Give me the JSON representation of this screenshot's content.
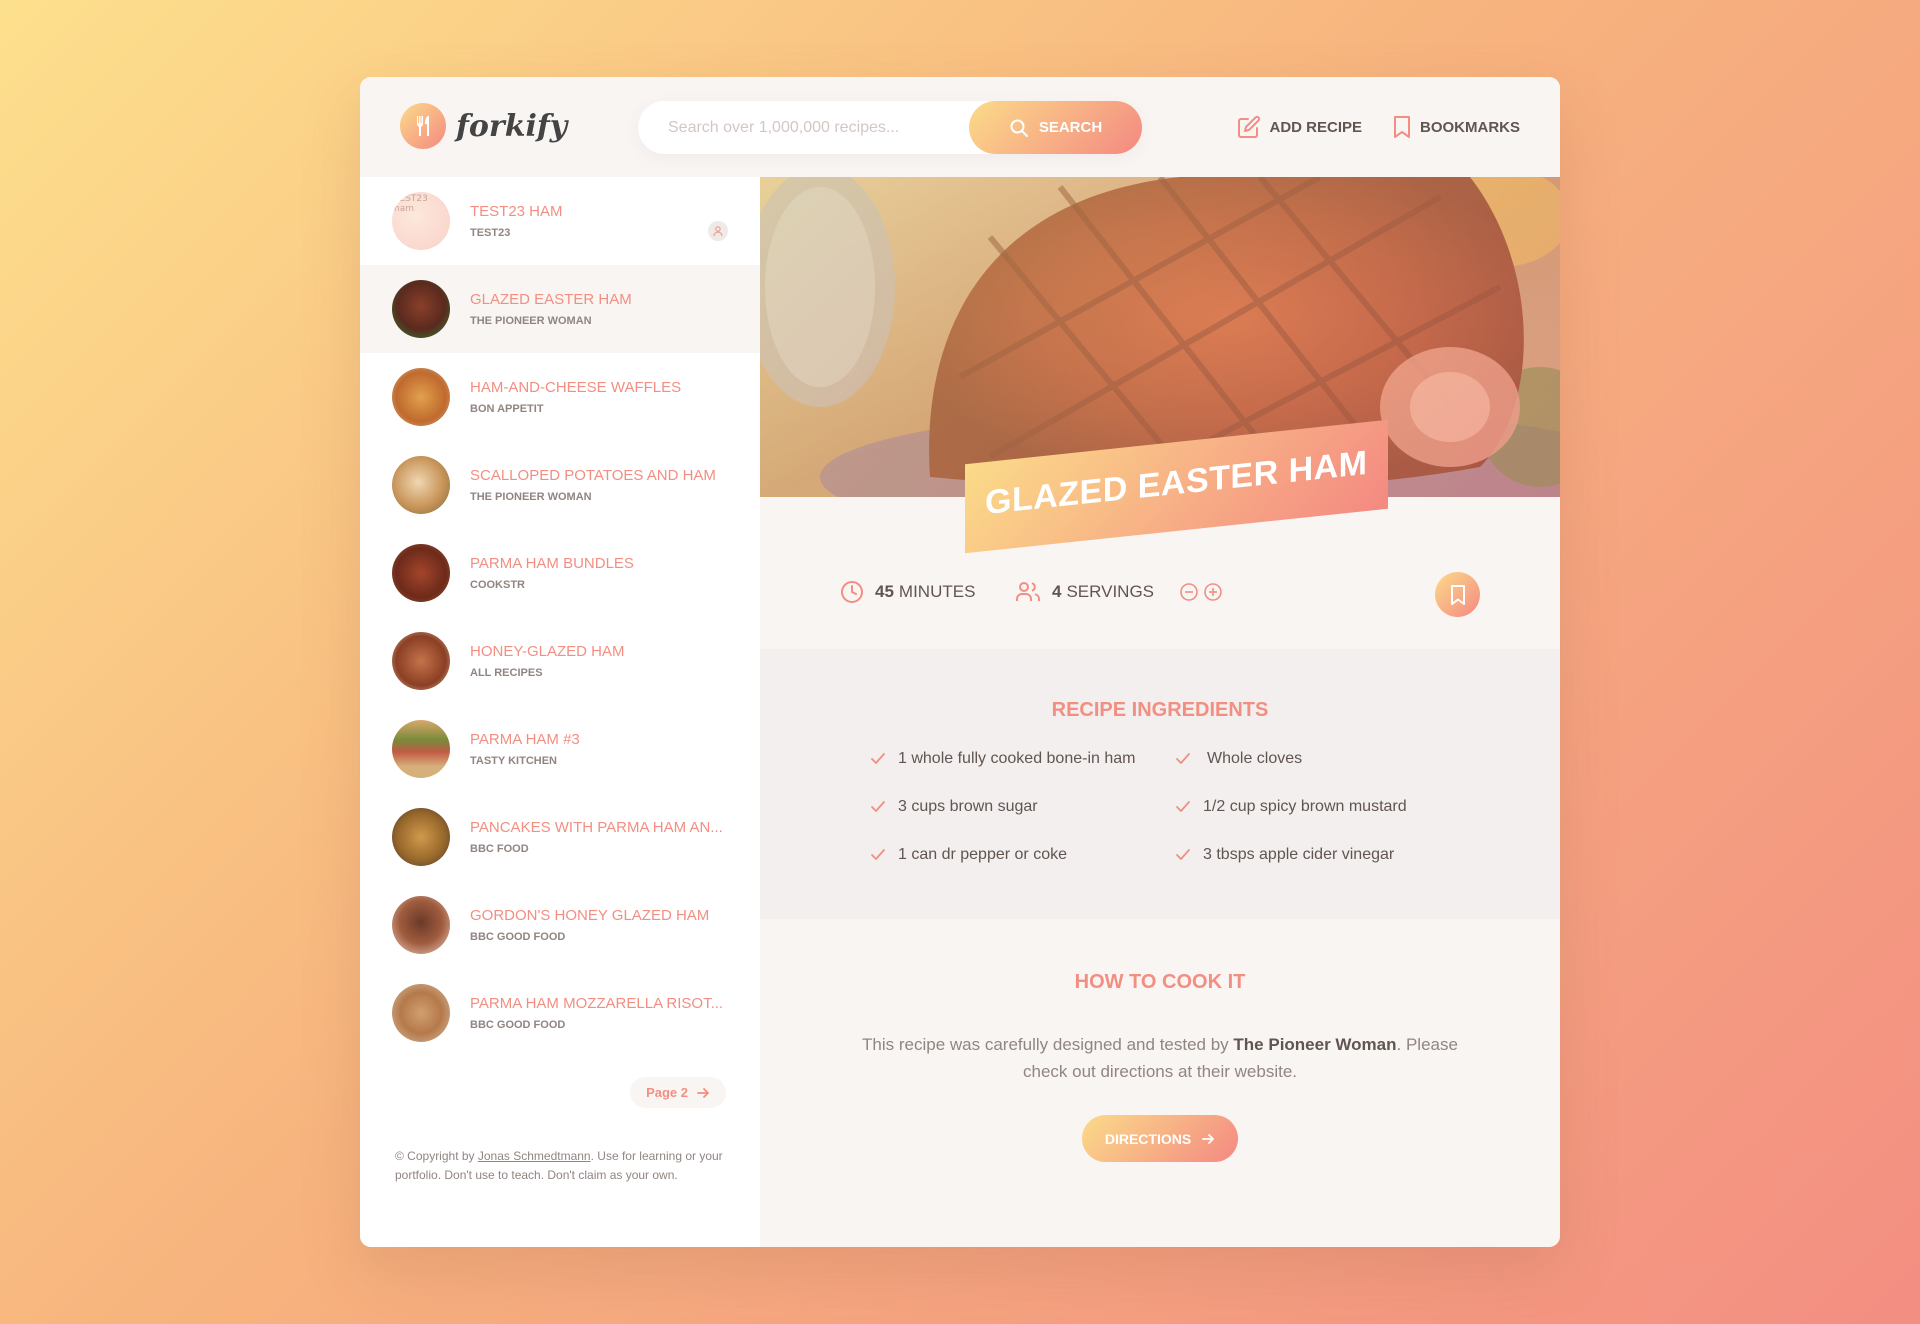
{
  "brand": {
    "name": "forkify"
  },
  "search": {
    "placeholder": "Search over 1,000,000 recipes...",
    "button_label": "Search"
  },
  "nav": {
    "add_recipe": "Add recipe",
    "bookmarks": "Bookmarks"
  },
  "results": [
    {
      "title": "TEST23 HAM",
      "publisher": "TEST23",
      "image_alt": "TEST23 ham",
      "user_generated": true,
      "active": false
    },
    {
      "title": "GLAZED EASTER HAM",
      "publisher": "THE PIONEER WOMAN",
      "active": true
    },
    {
      "title": "HAM-AND-CHEESE WAFFLES",
      "publisher": "BON APPETIT"
    },
    {
      "title": "SCALLOPED POTATOES AND HAM",
      "publisher": "THE PIONEER WOMAN"
    },
    {
      "title": "PARMA HAM BUNDLES",
      "publisher": "COOKSTR"
    },
    {
      "title": "HONEY-GLAZED HAM",
      "publisher": "ALL RECIPES"
    },
    {
      "title": "PARMA HAM #3",
      "publisher": "TASTY KITCHEN"
    },
    {
      "title": "PANCAKES WITH PARMA HAM AN...",
      "publisher": "BBC FOOD"
    },
    {
      "title": "GORDON'S HONEY GLAZED HAM",
      "publisher": "BBC GOOD FOOD"
    },
    {
      "title": "PARMA HAM MOZZARELLA RISOT...",
      "publisher": "BBC GOOD FOOD"
    }
  ],
  "pagination": {
    "next_label": "Page 2"
  },
  "copyright": {
    "prefix": "© Copyright by ",
    "author": "Jonas Schmedtmann",
    "suffix": ". Use for learning or your portfolio. Don't use to teach. Don't claim as your own."
  },
  "recipe": {
    "title": "GLAZED EASTER HAM",
    "cooking_time": "45",
    "time_unit": "MINUTES",
    "servings": "4",
    "servings_unit": "SERVINGS",
    "ingredients_heading": "RECIPE INGREDIENTS",
    "ingredients": [
      "1 whole fully cooked bone-in ham",
      "Whole cloves",
      "3 cups brown sugar",
      "1/2 cup spicy brown mustard",
      "1 can dr pepper or coke",
      "3 tbsps apple cider vinegar"
    ],
    "directions_heading": "HOW TO COOK IT",
    "directions_prefix": "This recipe was carefully designed and tested by ",
    "directions_publisher": "The Pioneer Woman",
    "directions_suffix": ". Please check out directions at their website.",
    "directions_button": "Directions"
  },
  "colors": {
    "accent_start": "#fbdb89",
    "accent_end": "#f48982",
    "accent_text": "#f38e82",
    "panel_bg": "#f9f5f3"
  }
}
